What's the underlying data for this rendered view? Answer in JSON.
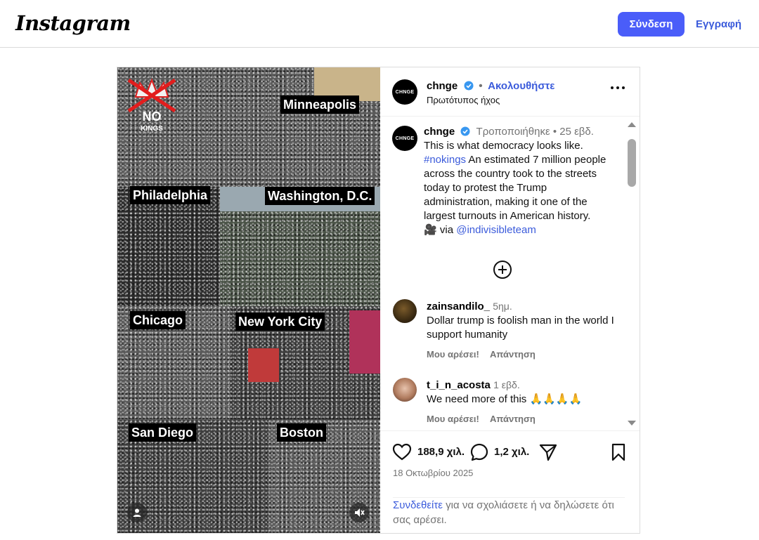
{
  "header": {
    "logo": "Instagram",
    "login_label": "Σύνδεση",
    "signup_label": "Εγγραφή"
  },
  "media": {
    "cities": [
      "Minneapolis",
      "Philadelphia",
      "Washington, D.C.",
      "Chicago",
      "New York City",
      "San Diego",
      "Boston"
    ],
    "badge": {
      "line1": "NO",
      "line2": "KINGS"
    },
    "icons": [
      "user-tag-icon",
      "mute-icon"
    ]
  },
  "post_header": {
    "avatar_text": "CHNGE",
    "username": "chnge",
    "separator": "•",
    "follow_label": "Ακολουθήστε",
    "audio": "Πρωτότυπος ήχος"
  },
  "caption": {
    "avatar_text": "CHNGE",
    "username": "chnge",
    "edited": "Τροποποιήθηκε",
    "separator": "•",
    "time": "25 εβδ.",
    "text_1": "This is what democracy looks like.",
    "hashtag": "#nokings",
    "text_2": "An estimated 7 million people across the country took to the streets today to protest the Trump administration, making it one of the largest turnouts in American history.",
    "emoji": "🎥",
    "via": "via",
    "mention": "@indivisibleteam"
  },
  "comments": [
    {
      "username": "zainsandilo_",
      "time": "5ημ.",
      "text": "Dollar trump is foolish man in the world I support humanity",
      "like_label": "Μου αρέσει!",
      "reply_label": "Απάντηση"
    },
    {
      "username": "t_i_n_acosta",
      "time": "1 εβδ.",
      "text": "We need more of this 🙏🙏🙏🙏",
      "like_label": "Μου αρέσει!",
      "reply_label": "Απάντηση"
    }
  ],
  "stats": {
    "likes": "188,9 χιλ.",
    "comments": "1,2 χιλ.",
    "date": "18 Οκτωβρίου 2025"
  },
  "login_prompt": {
    "link": "Συνδεθείτε",
    "text": "για να σχολιάσετε ή να δηλώσετε ότι σας αρέσει."
  },
  "colors": {
    "accent": "#4a5df9",
    "link": "#3b5bdb",
    "muted": "#737373",
    "border": "#dbdbdb"
  }
}
